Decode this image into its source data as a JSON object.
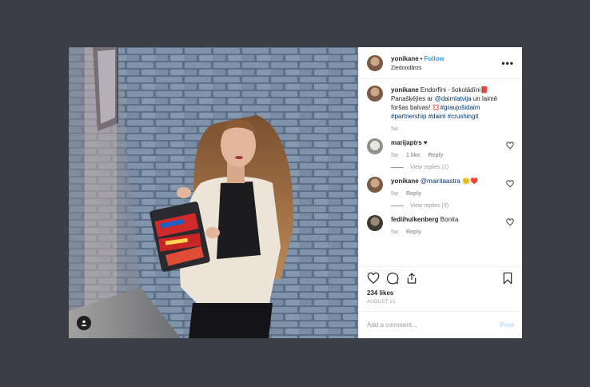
{
  "post": {
    "username": "yonikane",
    "dot": "•",
    "follow_label": "Follow",
    "location": "Ziedoņdārzs",
    "more_label": "•••",
    "caption": {
      "username": "yonikane",
      "text_1": " Endorfīni - šokolādīni",
      "emoji_1": "📕",
      "text_2": " Panašķējies ar ",
      "mention": "@daimlatvija",
      "text_3": " un laimē foršas balvas! ",
      "emoji_2": "💢",
      "hashtag_1": "#graujošidaim",
      "hashtag_2": "#partnership",
      "hashtag_3": "#daim",
      "hashtag_4": "#crushingit",
      "time": "5w"
    },
    "comments": [
      {
        "username": "marijaptrs",
        "text": " ♥",
        "time": "5w",
        "likes": "1 like",
        "reply": "Reply",
        "view_replies": "View replies (1)"
      },
      {
        "username": "yonikane",
        "mention": "@mairitaastra",
        "emoji": " 🙂❤️",
        "time": "5w",
        "reply": "Reply",
        "view_replies": "View replies (3)"
      },
      {
        "username": "fediihulkenberg",
        "text": " Bonita",
        "time": "5w",
        "reply": "Reply"
      }
    ],
    "likes": "234 likes",
    "date": "AUGUST 21",
    "comment_placeholder": "Add a comment...",
    "post_label": "Post"
  },
  "icons": {
    "like": "heart-icon",
    "comment": "comment-icon",
    "share": "share-icon",
    "save": "bookmark-icon",
    "user_tag": "user-tag-icon"
  },
  "colors": {
    "background": "#3c3d47",
    "link": "#3897f0",
    "mention": "#003569",
    "post_disabled": "#b2dffc"
  }
}
